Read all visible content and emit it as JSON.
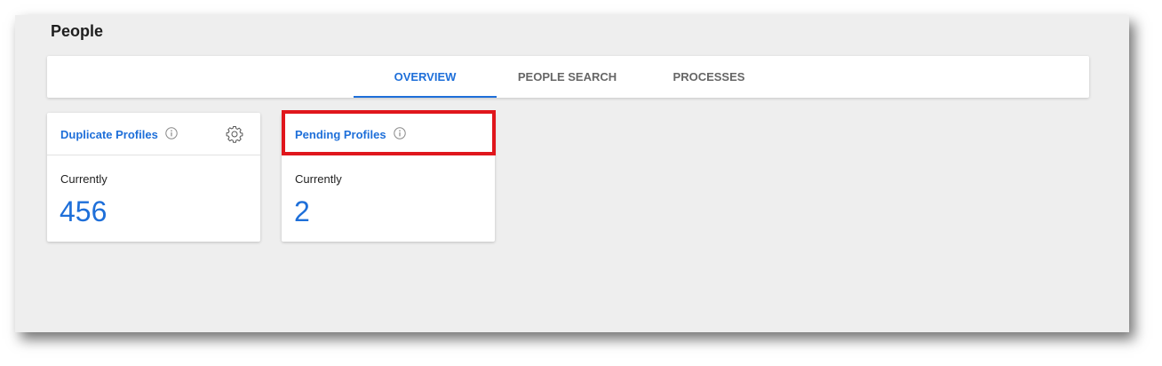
{
  "page": {
    "title": "People"
  },
  "tabs": [
    {
      "label": "OVERVIEW",
      "active": true
    },
    {
      "label": "PEOPLE SEARCH",
      "active": false
    },
    {
      "label": "PROCESSES",
      "active": false
    }
  ],
  "cards": [
    {
      "title": "Duplicate Profiles",
      "label": "Currently",
      "value": "456",
      "icons": [
        "info-icon",
        "gear-icon"
      ]
    },
    {
      "title": "Pending Profiles",
      "label": "Currently",
      "value": "2",
      "icons": [
        "info-icon"
      ]
    }
  ],
  "colors": {
    "accent": "#1e6fd9",
    "highlight": "#e0161c",
    "background": "#eeeeee"
  }
}
